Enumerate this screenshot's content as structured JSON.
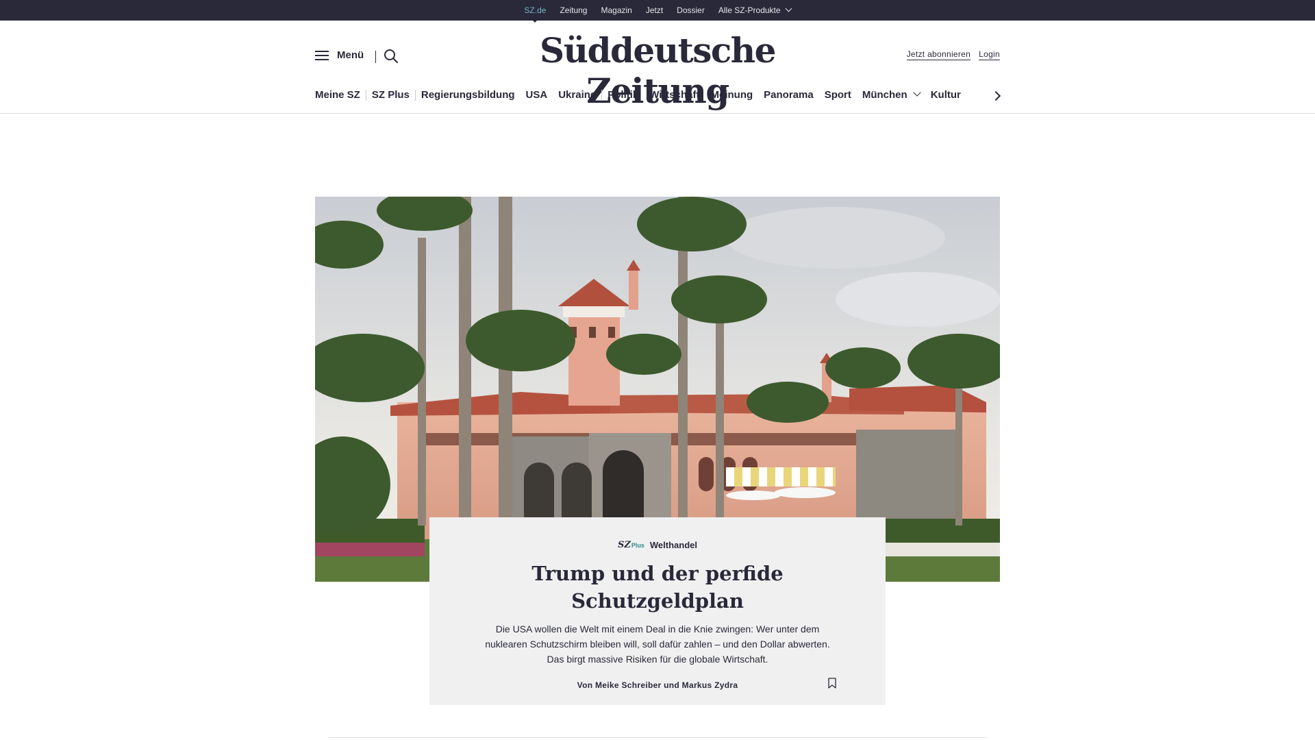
{
  "topbar": {
    "links": [
      "SZ.de",
      "Zeitung",
      "Magazin",
      "Jetzt",
      "Dossier"
    ],
    "products_label": "Alle SZ-Produkte"
  },
  "header": {
    "menu_label": "Menü",
    "logo_text": "Süddeutsche Zeitung",
    "subscribe_label": "Jetzt abonnieren",
    "login_label": "Login"
  },
  "nav": {
    "items": [
      "Meine SZ",
      "SZ Plus",
      "Regierungsbildung",
      "USA",
      "Ukraine",
      "Politik",
      "Wirtschaft",
      "Meinung",
      "Panorama",
      "Sport",
      "München",
      "Kultur"
    ]
  },
  "teaser": {
    "badge_sz": "SZ",
    "badge_plus": "Plus",
    "kicker": "Welthandel",
    "headline": "Trump und der perfide Schutzgeldplan",
    "summary": "Die USA wollen die Welt mit einem Deal in die Knie zwingen: Wer unter dem nuklearen Schutzschirm bleiben will, soll dafür zahlen – und den Dollar abwerten. Das birgt massive Risiken für die globale Wirtschaft.",
    "byline": "Von Meike Schreiber und Markus Zydra"
  },
  "colors": {
    "topbar_bg": "#29293a",
    "active_link": "#74b3c4",
    "plus_accent": "#2a8a86",
    "teaser_bg": "#f0f0f1"
  },
  "icons": [
    "hamburger-icon",
    "search-icon",
    "chevron-down-icon",
    "chevron-right-icon",
    "bookmark-icon"
  ]
}
